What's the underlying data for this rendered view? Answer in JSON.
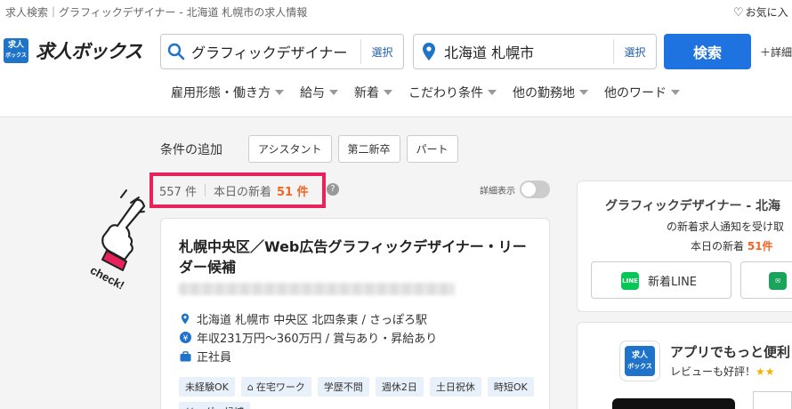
{
  "topbar": {
    "breadcrumb": "求人検索｜グラフィックデザイナー - 北海道 札幌市の求人情報",
    "favorites_label": "お気に入"
  },
  "header": {
    "logo_badge_line1": "求人",
    "logo_badge_line2": "ボックス",
    "logo_text": "求人ボックス",
    "keyword_value": "グラフィックデザイナー",
    "keyword_select": "選択",
    "location_value": "北海道 札幌市",
    "location_select": "選択",
    "search_button": "検索",
    "detail_search": "＋詳細"
  },
  "nav": {
    "items": [
      {
        "label": "雇用形態・働き方"
      },
      {
        "label": "給与"
      },
      {
        "label": "新着"
      },
      {
        "label": "こだわり条件"
      },
      {
        "label": "他の勤務地"
      },
      {
        "label": "他のワード"
      }
    ]
  },
  "conditions": {
    "label": "条件の追加",
    "chips": [
      "アシスタント",
      "第二新卒",
      "パート"
    ]
  },
  "results": {
    "count": "557 件",
    "today_label": "本日の新着",
    "today_count": "51 件",
    "help": "?",
    "detail_toggle_label": "詳細表示"
  },
  "annotation": {
    "check_text": "check!"
  },
  "job": {
    "title": "札幌中央区／Web広告グラフィックデザイナー・リーダー候補",
    "location": "北海道 札幌市 中央区 北四条東 / さっぽろ駅",
    "salary": "年収231万円〜360万円 / 賞与あり・昇給あり",
    "employment": "正社員",
    "tags": [
      "未経験OK",
      "在宅ワーク",
      "学歴不問",
      "週休2日",
      "土日祝休",
      "時短OK",
      "リーダー候補"
    ]
  },
  "sidebar": {
    "notify_title": "グラフィックデザイナー - 北海",
    "notify_sub": "の新着求人通知を受け取",
    "notify_today_label": "本日の新着",
    "notify_today_count": "51件",
    "line_button": "新着LINE",
    "app_title": "アプリでもっと便利",
    "app_sub": "レビューも好評！",
    "app_stars": "★★"
  },
  "colors": {
    "brand_blue": "#1f73c9",
    "search_blue": "#1f73e0",
    "highlight_red": "#e8235b",
    "accent_orange": "#f26522"
  }
}
